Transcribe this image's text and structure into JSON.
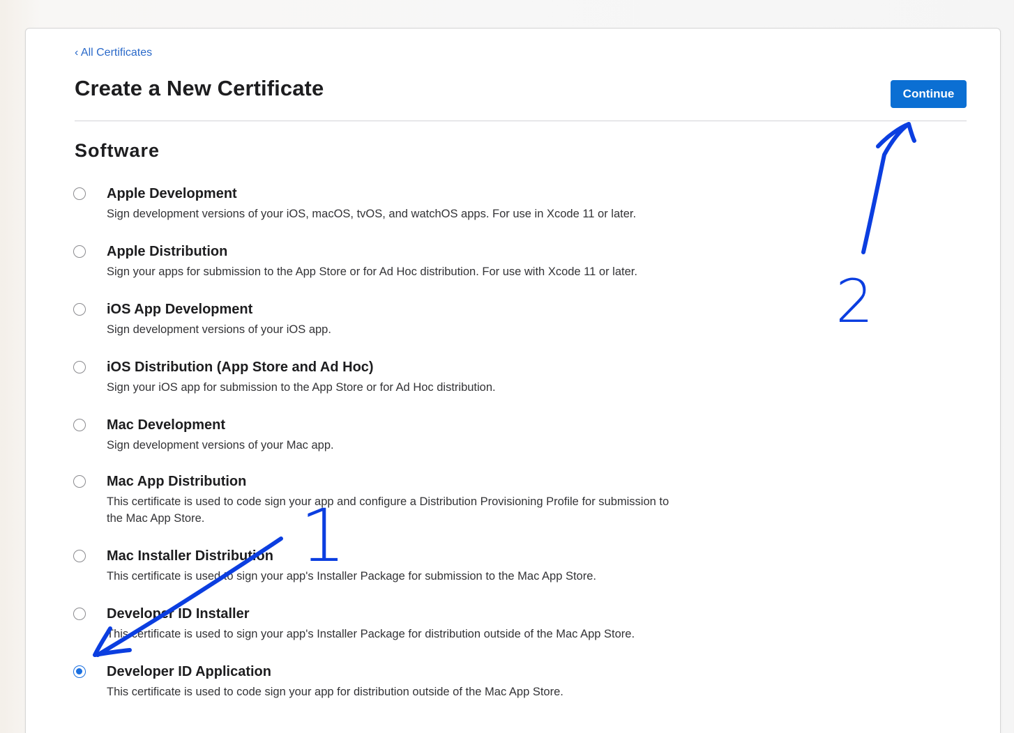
{
  "header": {
    "back_link": "‹ All Certificates",
    "title": "Create a New Certificate",
    "continue_label": "Continue"
  },
  "section": {
    "title": "Software"
  },
  "options": [
    {
      "label": "Apple Development",
      "description": "Sign development versions of your iOS, macOS, tvOS, and watchOS apps. For use in Xcode 11 or later.",
      "selected": false
    },
    {
      "label": "Apple Distribution",
      "description": "Sign your apps for submission to the App Store or for Ad Hoc distribution. For use with Xcode 11 or later.",
      "selected": false
    },
    {
      "label": "iOS App Development",
      "description": "Sign development versions of your iOS app.",
      "selected": false
    },
    {
      "label": "iOS Distribution (App Store and Ad Hoc)",
      "description": "Sign your iOS app for submission to the App Store or for Ad Hoc distribution.",
      "selected": false
    },
    {
      "label": "Mac Development",
      "description": "Sign development versions of your Mac app.",
      "selected": false
    },
    {
      "label": "Mac App Distribution",
      "description": "This certificate is used to code sign your app and configure a Distribution Provisioning Profile for submission to the Mac App Store.",
      "selected": false
    },
    {
      "label": "Mac Installer Distribution",
      "description": "This certificate is used to sign your app's Installer Package for submission to the Mac App Store.",
      "selected": false
    },
    {
      "label": "Developer ID Installer",
      "description": "This certificate is used to sign your app's Installer Package for distribution outside of the Mac App Store.",
      "selected": false
    },
    {
      "label": "Developer ID Application",
      "description": "This certificate is used to code sign your app for distribution outside of the Mac App Store.",
      "selected": true
    }
  ],
  "annotations": {
    "step_1": "1",
    "step_2": "2",
    "ink_color": "#0b3ee0"
  },
  "colors": {
    "link": "#2a69c9",
    "button": "#0b6fd3",
    "radio_selected": "#1a6fe0"
  }
}
